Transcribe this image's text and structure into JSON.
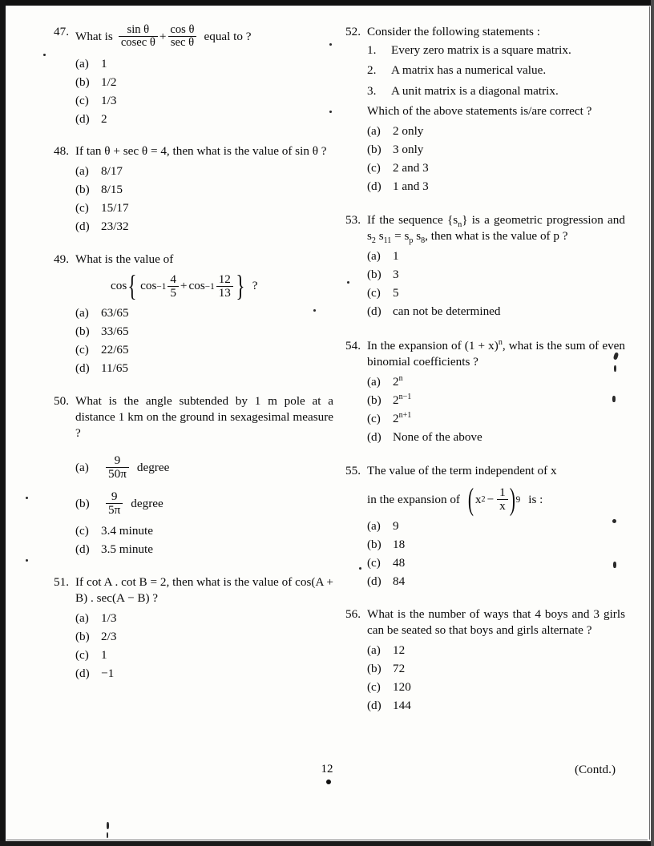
{
  "page": {
    "page_number": "12",
    "continued_label": "(Contd.)"
  },
  "questions": [
    {
      "number": "47.",
      "column": "left",
      "text_parts": {
        "pre": "What is",
        "post": "equal to ?"
      },
      "math": {
        "frac1_num": "sin θ",
        "frac1_den": "cosec θ",
        "operator": "+",
        "frac2_num": "cos θ",
        "frac2_den": "sec θ"
      },
      "options": [
        {
          "label": "(a)",
          "value": "1"
        },
        {
          "label": "(b)",
          "value": "1/2"
        },
        {
          "label": "(c)",
          "value": "1/3"
        },
        {
          "label": "(d)",
          "value": "2"
        }
      ]
    },
    {
      "number": "48.",
      "column": "left",
      "text": "If tan θ + sec θ = 4, then what is the value of sin θ ?",
      "options": [
        {
          "label": "(a)",
          "value": "8/17"
        },
        {
          "label": "(b)",
          "value": "8/15"
        },
        {
          "label": "(c)",
          "value": "15/17"
        },
        {
          "label": "(d)",
          "value": "23/32"
        }
      ]
    },
    {
      "number": "49.",
      "column": "left",
      "text": "What is the value of",
      "math": {
        "fn": "cos",
        "open_brace": "{",
        "inner_fn1": "cos",
        "inner_exp1": "−1",
        "f1_num": "4",
        "f1_den": "5",
        "operator": "+",
        "inner_fn2": "cos",
        "inner_exp2": "−1",
        "f2_num": "12",
        "f2_den": "13",
        "close_brace": "}",
        "question_mark": "?"
      },
      "options": [
        {
          "label": "(a)",
          "value": "63/65"
        },
        {
          "label": "(b)",
          "value": "33/65"
        },
        {
          "label": "(c)",
          "value": "22/65"
        },
        {
          "label": "(d)",
          "value": "11/65"
        }
      ]
    },
    {
      "number": "50.",
      "column": "left",
      "text": "What is the angle subtended by 1 m pole at a distance 1 km on the ground in sexagesimal measure ?",
      "options": [
        {
          "label": "(a)",
          "frac_num": "9",
          "frac_den": "50π",
          "suffix": "degree"
        },
        {
          "label": "(b)",
          "frac_num": "9",
          "frac_den": "5π",
          "suffix": "degree"
        },
        {
          "label": "(c)",
          "value": "3.4 minute"
        },
        {
          "label": "(d)",
          "value": "3.5 minute"
        }
      ]
    },
    {
      "number": "51.",
      "column": "left",
      "text": "If cot A . cot B = 2, then what is the value of cos(A + B) . sec(A − B) ?",
      "options": [
        {
          "label": "(a)",
          "value": "1/3"
        },
        {
          "label": "(b)",
          "value": "2/3"
        },
        {
          "label": "(c)",
          "value": "1"
        },
        {
          "label": "(d)",
          "value": "−1"
        }
      ]
    },
    {
      "number": "52.",
      "column": "right",
      "text": "Consider the following statements :",
      "statements": [
        {
          "num": "1.",
          "text": "Every zero matrix is a square matrix."
        },
        {
          "num": "2.",
          "text": "A matrix has a numerical value."
        },
        {
          "num": "3.",
          "text": "A unit matrix is a diagonal matrix."
        }
      ],
      "follow_up": "Which of the above statements is/are correct ?",
      "options": [
        {
          "label": "(a)",
          "value": "2 only"
        },
        {
          "label": "(b)",
          "value": "3 only"
        },
        {
          "label": "(c)",
          "value": "2 and 3"
        },
        {
          "label": "(d)",
          "value": "1 and 3"
        }
      ]
    },
    {
      "number": "53.",
      "column": "right",
      "text_line1_a": "If the sequence {s",
      "text_line1_sub": "n",
      "text_line1_b": "} is a geometric progression and s",
      "sub_2": "2",
      "mid_a": " s",
      "sub_11": "11",
      "mid_b": " = s",
      "sub_p": "p",
      "mid_c": " s",
      "sub_8": "8",
      "tail": ", then what is the value of p ?",
      "options": [
        {
          "label": "(a)",
          "value": "1"
        },
        {
          "label": "(b)",
          "value": "3"
        },
        {
          "label": "(c)",
          "value": "5"
        },
        {
          "label": "(d)",
          "value": "can not be determined"
        }
      ]
    },
    {
      "number": "54.",
      "column": "right",
      "text_a": "In the expansion of (1 + x)",
      "text_sup": "n",
      "text_b": ", what is the sum of even binomial coefficients ?",
      "options": [
        {
          "label": "(a)",
          "base": "2",
          "exp": "n"
        },
        {
          "label": "(b)",
          "base": "2",
          "exp": "n−1"
        },
        {
          "label": "(c)",
          "base": "2",
          "exp": "n+1"
        },
        {
          "label": "(d)",
          "value": "None of the above"
        }
      ]
    },
    {
      "number": "55.",
      "column": "right",
      "text": "The value of the term independent of x",
      "math": {
        "prefix": "in the expansion of",
        "open_paren": "(",
        "base_var": "x",
        "base_exp": "2",
        "minus": "−",
        "frac_num": "1",
        "frac_den": "x",
        "close_paren": ")",
        "outer_exp": "9",
        "suffix": "is :"
      },
      "options": [
        {
          "label": "(a)",
          "value": "9"
        },
        {
          "label": "(b)",
          "value": "18"
        },
        {
          "label": "(c)",
          "value": "48"
        },
        {
          "label": "(d)",
          "value": "84"
        }
      ]
    },
    {
      "number": "56.",
      "column": "right",
      "text": "What is the number of ways that 4 boys and 3 girls can be seated so that boys and girls alternate ?",
      "options": [
        {
          "label": "(a)",
          "value": "12"
        },
        {
          "label": "(b)",
          "value": "72"
        },
        {
          "label": "(c)",
          "value": "120"
        },
        {
          "label": "(d)",
          "value": "144"
        }
      ]
    }
  ]
}
